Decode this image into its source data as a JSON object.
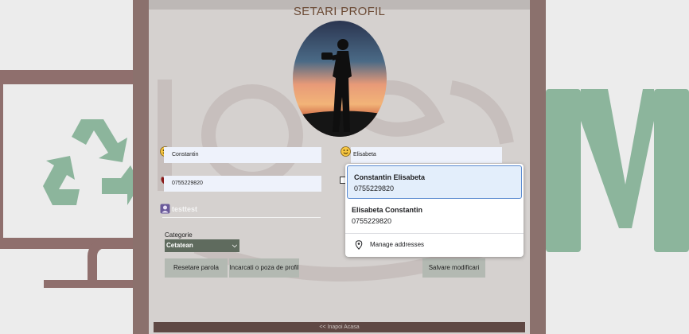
{
  "page": {
    "title": "SETARI PROFIL"
  },
  "profile": {
    "first_name": "Constantin",
    "last_name": "Elisabeta",
    "phone": "0755229820",
    "email": "",
    "username": "testtest"
  },
  "category": {
    "label": "Categorie",
    "selected": "Cetatean"
  },
  "buttons": {
    "reset_password": "Resetare parola",
    "upload_photo": "Incarcati o poza de profil",
    "save": "Salvare modificari",
    "back_home": "<< Inapoi Acasa"
  },
  "autocomplete": {
    "suggestions": [
      {
        "name": "Constantin Elisabeta",
        "phone": "0755229820"
      },
      {
        "name": "Elisabeta Constantin",
        "phone": "0755229820"
      }
    ],
    "manage_label": "Manage addresses"
  },
  "icons": {
    "first_name": "smiley-icon",
    "last_name": "smiley-icon",
    "phone": "phone-icon",
    "username": "user-badge-icon",
    "manage": "location-pin-icon"
  },
  "colors": {
    "panel_border": "#8b716d",
    "panel_bg": "#d5d1cf",
    "title": "#6b4a35",
    "field_bg": "#eef2fb",
    "button_bg": "#b3b9b2",
    "select_bg": "#5f6b5e",
    "decor_green": "#8cb59c"
  }
}
